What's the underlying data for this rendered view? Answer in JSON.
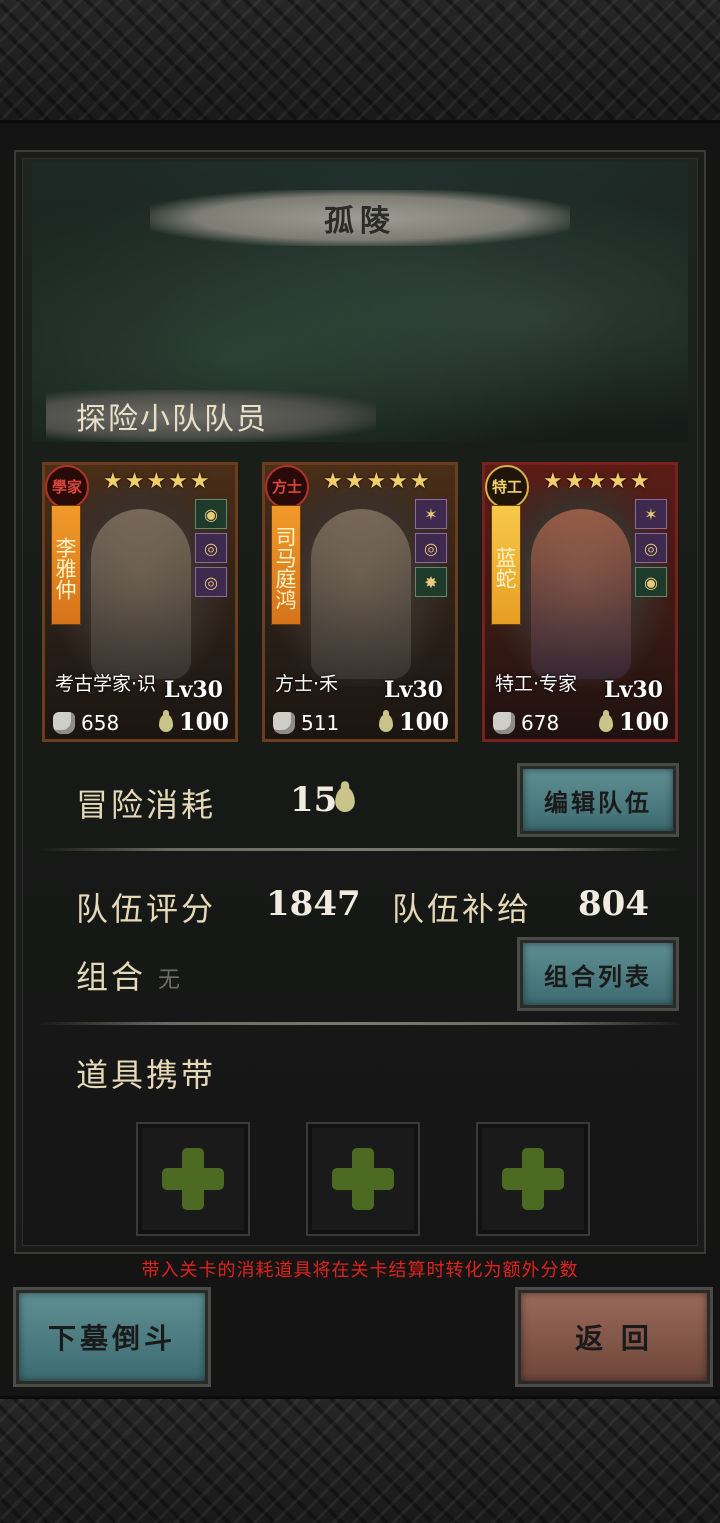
{
  "stage": {
    "title": "孤陵"
  },
  "team_section": {
    "title": "探险小队队员"
  },
  "members": [
    {
      "class_badge": "學家",
      "name": "李雅仲",
      "stars": "★★★★★",
      "job": "考古学家·识",
      "level": "Lv30",
      "power": "658",
      "supply": "100",
      "skills": [
        "coin-skill-icon",
        "ring-skill-icon",
        "ring-skill-icon"
      ]
    },
    {
      "class_badge": "方士",
      "name": "司马庭鸿",
      "stars": "★★★★★",
      "job": "方士·禾",
      "level": "Lv30",
      "power": "511",
      "supply": "100",
      "skills": [
        "bug-skill-icon",
        "ring-skill-icon",
        "star-skill-icon"
      ]
    },
    {
      "class_badge": "特工",
      "name": "蓝蛇",
      "stars": "★★★★★",
      "job": "特工·专家",
      "level": "Lv30",
      "power": "678",
      "supply": "100",
      "skills": [
        "bug-skill-icon",
        "ring-skill-icon",
        "coin-skill-icon"
      ]
    }
  ],
  "adventure": {
    "label": "冒险消耗",
    "cost": "15",
    "edit_button": "编辑队伍"
  },
  "team_stats": {
    "score_label": "队伍评分",
    "score": "1847",
    "supply_label": "队伍补给",
    "supply": "804"
  },
  "combo": {
    "label": "组合",
    "value": "无",
    "list_button": "组合列表"
  },
  "items": {
    "label": "道具携带",
    "slots": 3
  },
  "notice": "带入关卡的消耗道具将在关卡结算时转化为额外分数",
  "actions": {
    "start_button": "下墓倒斗",
    "back_button": "返 回"
  }
}
